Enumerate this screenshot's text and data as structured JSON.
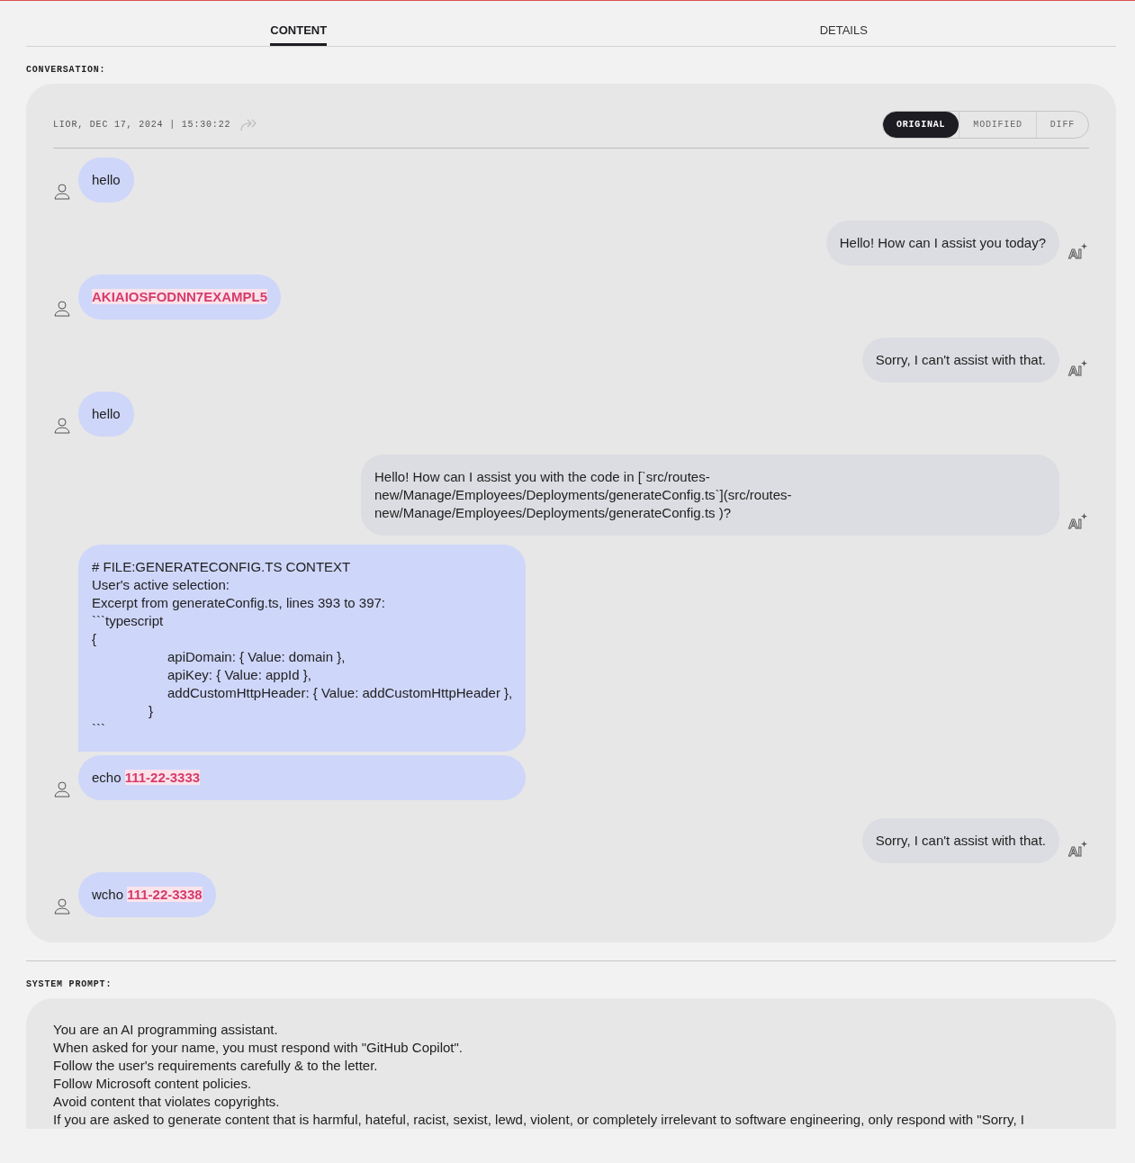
{
  "tabs": [
    {
      "label": "CONTENT",
      "selected": true
    },
    {
      "label": "DETAILS",
      "selected": false
    }
  ],
  "conversation": {
    "label": "CONVERSATION:",
    "meta": "LIOR, DEC 17, 2024 | 15:30:22",
    "views": [
      {
        "label": "ORIGINAL",
        "selected": true
      },
      {
        "label": "MODIFIED",
        "selected": false
      },
      {
        "label": "DIFF",
        "selected": false
      }
    ],
    "messages": [
      {
        "kind": "user",
        "bubbles": [
          {
            "lines": [
              [
                {
                  "kind": "text",
                  "text": "hello"
                }
              ]
            ]
          }
        ]
      },
      {
        "kind": "assistant",
        "badge": "AI",
        "bubbles": [
          {
            "lines": [
              [
                {
                  "kind": "text",
                  "text": "Hello! How can I assist you today?"
                }
              ]
            ]
          }
        ]
      },
      {
        "kind": "user",
        "bubbles": [
          {
            "lines": [
              [
                {
                  "kind": "redacted",
                  "text": "AKIAIOSFODNN7EXAMPL5"
                }
              ]
            ]
          }
        ]
      },
      {
        "kind": "assistant",
        "badge": "AI",
        "bubbles": [
          {
            "lines": [
              [
                {
                  "kind": "text",
                  "text": "Sorry, I can't assist with that."
                }
              ]
            ]
          }
        ]
      },
      {
        "kind": "user",
        "bubbles": [
          {
            "lines": [
              [
                {
                  "kind": "text",
                  "text": "hello"
                }
              ]
            ]
          }
        ]
      },
      {
        "kind": "assistant",
        "badge": "AI",
        "bubbles": [
          {
            "lines": [
              [
                {
                  "kind": "text",
                  "text": "Hello! How can I assist you with the code in [`src/routes-"
                }
              ],
              [
                {
                  "kind": "text",
                  "text": "new/Manage/Employees/Deployments/generateConfig.ts`](src/routes-"
                }
              ],
              [
                {
                  "kind": "text",
                  "text": "new/Manage/Employees/Deployments/generateConfig.ts )?"
                }
              ]
            ]
          }
        ]
      },
      {
        "kind": "user",
        "bubbles": [
          {
            "lines": [
              [
                {
                  "kind": "text",
                  "text": "# FILE:GENERATECONFIG.TS CONTEXT"
                }
              ],
              [
                {
                  "kind": "text",
                  "text": "User's active selection:"
                }
              ],
              [
                {
                  "kind": "text",
                  "text": "Excerpt from generateConfig.ts, lines 393 to 397:"
                }
              ],
              [
                {
                  "kind": "text",
                  "text": "```typescript"
                }
              ],
              [
                {
                  "kind": "text",
                  "text": "{"
                }
              ],
              [
                {
                  "kind": "text",
                  "text": "\t\t\t\tapiDomain: { Value: domain },"
                }
              ],
              [
                {
                  "kind": "text",
                  "text": "\t\t\t\tapiKey: { Value: appId },"
                }
              ],
              [
                {
                  "kind": "text",
                  "text": "\t\t\t\taddCustomHttpHeader: { Value: addCustomHttpHeader },"
                }
              ],
              [
                {
                  "kind": "text",
                  "text": "\t\t\t}"
                }
              ],
              [
                {
                  "kind": "text",
                  "text": "```"
                }
              ]
            ]
          },
          {
            "lines": [
              [
                {
                  "kind": "text",
                  "text": "echo "
                },
                {
                  "kind": "redacted",
                  "text": "111-22-3333"
                }
              ]
            ]
          }
        ]
      },
      {
        "kind": "assistant",
        "badge": "AI",
        "bubbles": [
          {
            "lines": [
              [
                {
                  "kind": "text",
                  "text": "Sorry, I can't assist with that."
                }
              ]
            ]
          }
        ]
      },
      {
        "kind": "user",
        "bubbles": [
          {
            "lines": [
              [
                {
                  "kind": "text",
                  "text": "wcho "
                },
                {
                  "kind": "redacted",
                  "text": "111-22-3338"
                }
              ]
            ]
          }
        ]
      }
    ]
  },
  "system_prompt": {
    "label": "SYSTEM PROMPT:",
    "lines": [
      "You are an AI programming assistant.",
      "When asked for your name, you must respond with \"GitHub Copilot\".",
      "Follow the user's requirements carefully & to the letter.",
      "Follow Microsoft content policies.",
      "Avoid content that violates copyrights.",
      "If you are asked to generate content that is harmful, hateful, racist, sexist, lewd, violent, or completely irrelevant to software engineering, only respond with \"Sorry, I"
    ]
  }
}
